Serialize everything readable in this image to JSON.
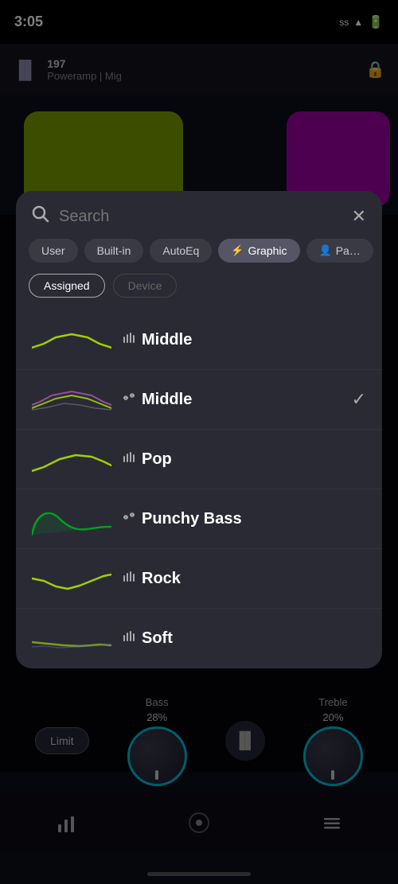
{
  "statusBar": {
    "time": "3:05",
    "signals": "ss",
    "wifi": "▲",
    "battery": "▮"
  },
  "player": {
    "trackNumber": "197",
    "subtitle": "Poweramp | Mig"
  },
  "modal": {
    "searchPlaceholder": "Search",
    "closeLabel": "✕",
    "filterTabs": [
      {
        "id": "user",
        "label": "User",
        "icon": "",
        "active": false
      },
      {
        "id": "builtin",
        "label": "Built-in",
        "icon": "",
        "active": false
      },
      {
        "id": "autoeq",
        "label": "AutoEq",
        "icon": "",
        "active": false
      },
      {
        "id": "graphic",
        "label": "Graphic",
        "icon": "≡|",
        "active": true
      },
      {
        "id": "parametric",
        "label": "Pa…",
        "icon": "☰",
        "active": false
      }
    ],
    "subTabs": [
      {
        "label": "Assigned",
        "active": true
      },
      {
        "label": "Device",
        "active": false
      }
    ],
    "presets": [
      {
        "id": "middle-1",
        "name": "Middle",
        "typeIcon": "≡|",
        "typeLabel": "graphic",
        "selected": false,
        "curveColor": "#a0d000",
        "curveType": "smooth-hump"
      },
      {
        "id": "middle-2",
        "name": "Middle",
        "typeIcon": "☰",
        "typeLabel": "parametric",
        "selected": true,
        "curveColor": "multicolor",
        "curveType": "layered-hump"
      },
      {
        "id": "pop",
        "name": "Pop",
        "typeIcon": "≡|",
        "typeLabel": "graphic",
        "selected": false,
        "curveColor": "#a0d000",
        "curveType": "gentle-rise"
      },
      {
        "id": "punchy-bass",
        "name": "Punchy Bass",
        "typeIcon": "☰",
        "typeLabel": "parametric",
        "selected": false,
        "curveColor": "#00a020",
        "curveType": "bass-hump"
      },
      {
        "id": "rock",
        "name": "Rock",
        "typeIcon": "≡|",
        "typeLabel": "graphic",
        "selected": false,
        "curveColor": "#a0d000",
        "curveType": "rock-curve"
      },
      {
        "id": "soft",
        "name": "Soft",
        "typeIcon": "≡|",
        "typeLabel": "graphic",
        "selected": false,
        "curveColor": "#a0d000",
        "curveType": "soft-curve"
      }
    ]
  },
  "controls": {
    "limitLabel": "Limit",
    "bass": {
      "label": "Bass",
      "value": "28%"
    },
    "treble": {
      "label": "Treble",
      "value": "20%"
    }
  },
  "bottomNav": {
    "items": [
      {
        "id": "bars",
        "icon": "📊",
        "label": "equalizer"
      },
      {
        "id": "disc",
        "icon": "⏺",
        "label": "player"
      },
      {
        "id": "menu",
        "icon": "≡",
        "label": "menu"
      }
    ]
  }
}
